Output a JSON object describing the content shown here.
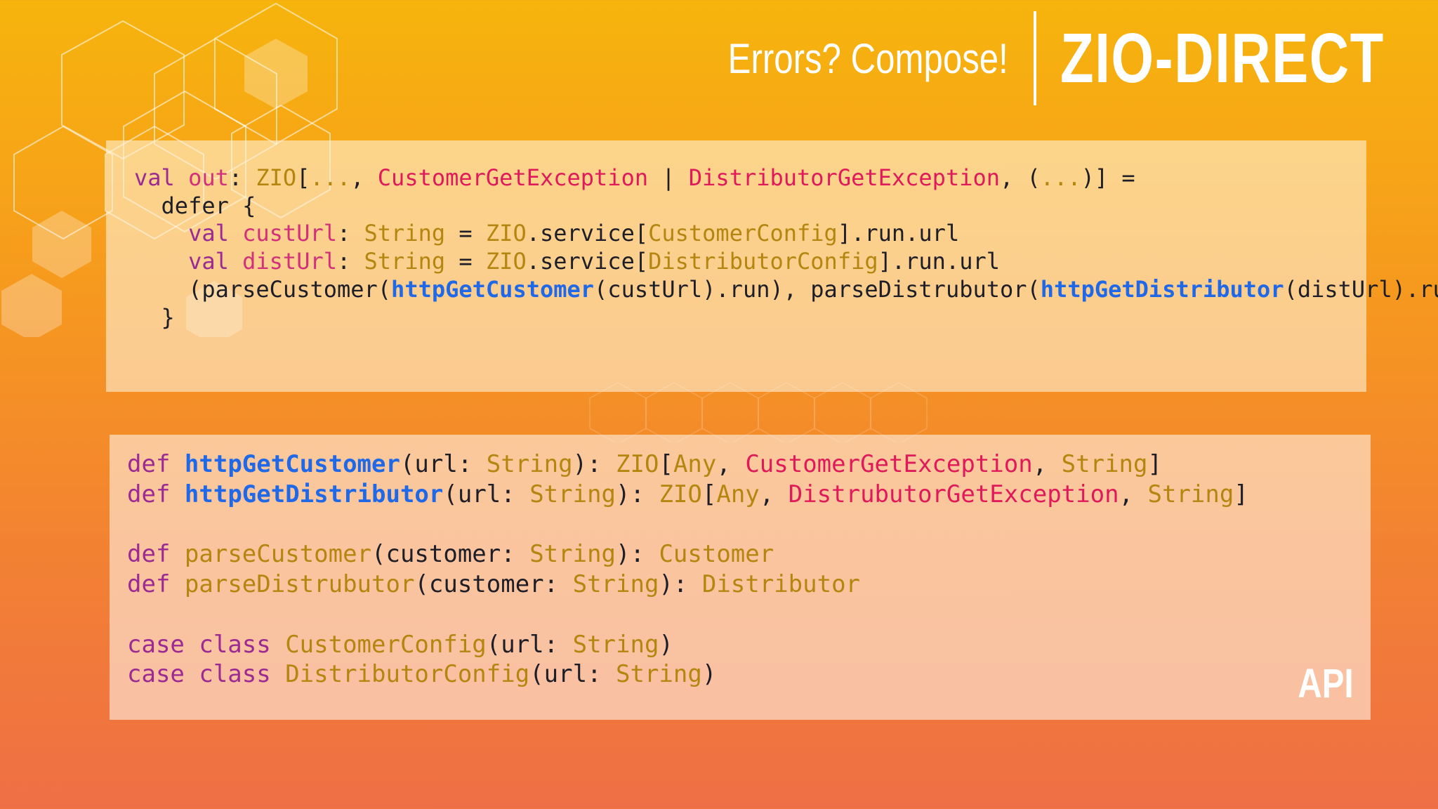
{
  "header": {
    "subtitle": "Errors? Compose!",
    "brand": "ZIO-DIRECT"
  },
  "panel_top": {
    "lines": [
      [
        {
          "t": "val",
          "c": "k"
        },
        {
          "t": " "
        },
        {
          "t": "out",
          "c": "v"
        },
        {
          "t": ": "
        },
        {
          "t": "ZIO",
          "c": "t"
        },
        {
          "t": "["
        },
        {
          "t": "...",
          "c": "t"
        },
        {
          "t": ", "
        },
        {
          "t": "CustomerGetException",
          "c": "e"
        },
        {
          "t": " | "
        },
        {
          "t": "DistributorGetException",
          "c": "e"
        },
        {
          "t": ", ("
        },
        {
          "t": "...",
          "c": "t"
        },
        {
          "t": ")] ="
        }
      ],
      [
        {
          "t": "  defer {"
        }
      ],
      [
        {
          "t": "    "
        },
        {
          "t": "val",
          "c": "k"
        },
        {
          "t": " "
        },
        {
          "t": "custUrl",
          "c": "v"
        },
        {
          "t": ": "
        },
        {
          "t": "String",
          "c": "t"
        },
        {
          "t": " = "
        },
        {
          "t": "ZIO",
          "c": "t"
        },
        {
          "t": ".service["
        },
        {
          "t": "CustomerConfig",
          "c": "t"
        },
        {
          "t": "].run.url"
        }
      ],
      [
        {
          "t": "    "
        },
        {
          "t": "val",
          "c": "k"
        },
        {
          "t": " "
        },
        {
          "t": "distUrl",
          "c": "v"
        },
        {
          "t": ": "
        },
        {
          "t": "String",
          "c": "t"
        },
        {
          "t": " = "
        },
        {
          "t": "ZIO",
          "c": "t"
        },
        {
          "t": ".service["
        },
        {
          "t": "DistributorConfig",
          "c": "t"
        },
        {
          "t": "].run.url"
        }
      ],
      [
        {
          "t": "    (parseCustomer("
        },
        {
          "t": "httpGetCustomer",
          "c": "f"
        },
        {
          "t": "(custUrl).run), parseDistrubutor("
        },
        {
          "t": "httpGetDistributor",
          "c": "f"
        },
        {
          "t": "(distUrl).run))"
        }
      ],
      [
        {
          "t": "  }"
        }
      ]
    ]
  },
  "panel_bottom": {
    "lines": [
      [
        {
          "t": "def",
          "c": "k"
        },
        {
          "t": " "
        },
        {
          "t": "httpGetCustomer",
          "c": "f"
        },
        {
          "t": "(url: "
        },
        {
          "t": "String",
          "c": "t"
        },
        {
          "t": "): "
        },
        {
          "t": "ZIO",
          "c": "t"
        },
        {
          "t": "["
        },
        {
          "t": "Any",
          "c": "t"
        },
        {
          "t": ", "
        },
        {
          "t": "CustomerGetException",
          "c": "e"
        },
        {
          "t": ", "
        },
        {
          "t": "String",
          "c": "t"
        },
        {
          "t": "]"
        }
      ],
      [
        {
          "t": "def",
          "c": "k"
        },
        {
          "t": " "
        },
        {
          "t": "httpGetDistributor",
          "c": "f"
        },
        {
          "t": "(url: "
        },
        {
          "t": "String",
          "c": "t"
        },
        {
          "t": "): "
        },
        {
          "t": "ZIO",
          "c": "t"
        },
        {
          "t": "["
        },
        {
          "t": "Any",
          "c": "t"
        },
        {
          "t": ", "
        },
        {
          "t": "DistrubutorGetException",
          "c": "e"
        },
        {
          "t": ", "
        },
        {
          "t": "String",
          "c": "t"
        },
        {
          "t": "]"
        }
      ],
      [],
      [
        {
          "t": "def",
          "c": "k"
        },
        {
          "t": " "
        },
        {
          "t": "parseCustomer",
          "c": "fn"
        },
        {
          "t": "(customer: "
        },
        {
          "t": "String",
          "c": "t"
        },
        {
          "t": "): "
        },
        {
          "t": "Customer",
          "c": "t"
        }
      ],
      [
        {
          "t": "def",
          "c": "k"
        },
        {
          "t": " "
        },
        {
          "t": "parseDistrubutor",
          "c": "fn"
        },
        {
          "t": "(customer: "
        },
        {
          "t": "String",
          "c": "t"
        },
        {
          "t": "): "
        },
        {
          "t": "Distributor",
          "c": "t"
        }
      ],
      [],
      [
        {
          "t": "case class",
          "c": "k"
        },
        {
          "t": " "
        },
        {
          "t": "CustomerConfig",
          "c": "fn"
        },
        {
          "t": "(url: "
        },
        {
          "t": "String",
          "c": "t"
        },
        {
          "t": ")"
        }
      ],
      [
        {
          "t": "case class",
          "c": "k"
        },
        {
          "t": " "
        },
        {
          "t": "DistributorConfig",
          "c": "fn"
        },
        {
          "t": "(url: "
        },
        {
          "t": "String",
          "c": "t"
        },
        {
          "t": ")"
        }
      ]
    ]
  },
  "corner_label": "API"
}
